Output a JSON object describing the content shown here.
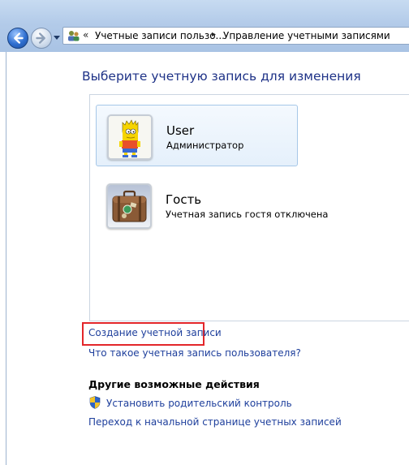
{
  "breadcrumb": {
    "parent": "Учетные записи пользо...",
    "current": "Управление учетными записями",
    "overflow_glyph": "«",
    "separator_glyph": "▸"
  },
  "heading": "Выберите учетную запись для изменения",
  "accounts": [
    {
      "name": "User",
      "role": "Администратор",
      "selected": true,
      "picture": "bart-simpson-avatar"
    },
    {
      "name": "Гость",
      "role": "Учетная запись гостя отключена",
      "selected": false,
      "picture": "suitcase-avatar"
    }
  ],
  "links": {
    "create_account": "Создание учетной записи",
    "what_is_account": "Что такое учетная запись пользователя?"
  },
  "other_actions": {
    "title": "Другие возможные действия",
    "parental_control": "Установить родительский контроль",
    "home": "Переход к начальной странице учетных записей"
  },
  "colors": {
    "link": "#1e3f9c",
    "heading": "#1e3287",
    "highlight_box": "#e3262a",
    "selected_bg": "#e5f0fb"
  }
}
